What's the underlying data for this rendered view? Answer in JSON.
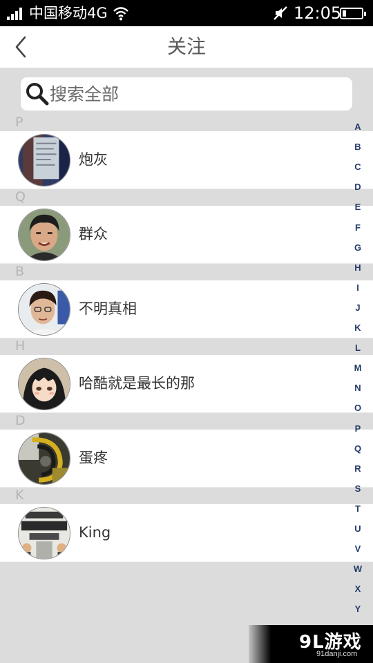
{
  "status_bar": {
    "carrier": "中国移动4G",
    "time": "12:05",
    "battery_level": 0.2
  },
  "nav": {
    "title": "关注"
  },
  "search": {
    "placeholder": "搜索全部"
  },
  "sections": [
    {
      "letter": "P",
      "name": "炮灰"
    },
    {
      "letter": "Q",
      "name": "群众"
    },
    {
      "letter": "B",
      "name": "不明真相"
    },
    {
      "letter": "H",
      "name": "哈酷就是最长的那"
    },
    {
      "letter": "D",
      "name": "蛋疼"
    },
    {
      "letter": "K",
      "name": "King"
    }
  ],
  "index_letters": [
    "A",
    "B",
    "C",
    "D",
    "E",
    "F",
    "G",
    "H",
    "I",
    "J",
    "K",
    "L",
    "M",
    "N",
    "O",
    "P",
    "Q",
    "R",
    "S",
    "T",
    "U",
    "V",
    "W",
    "X",
    "Y"
  ],
  "watermark": {
    "logo": "9L游戏",
    "url": "91danji.com"
  },
  "colors": {
    "page_bg": "#dcdcdc",
    "index_letters": "#223a66",
    "section_header": "#b4b4b4"
  }
}
